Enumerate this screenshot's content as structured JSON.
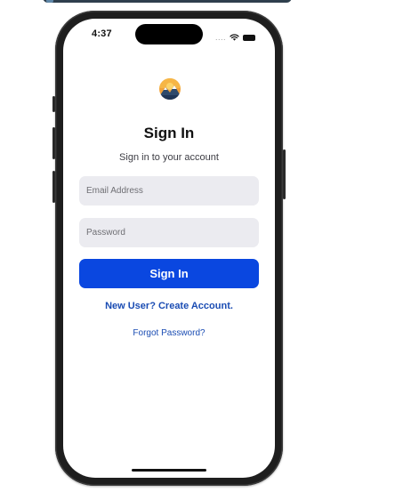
{
  "status_bar": {
    "time": "4:37",
    "signal_text": "....",
    "icons": [
      "wifi-icon",
      "battery-icon"
    ]
  },
  "logo": {
    "icon": "mountain-sunset-logo"
  },
  "heading": {
    "title": "Sign In",
    "subtitle": "Sign in to your account"
  },
  "form": {
    "email_placeholder": "Email Address",
    "email_value": "",
    "password_placeholder": "Password",
    "password_value": "",
    "submit_label": "Sign In"
  },
  "links": {
    "create_account": "New User? Create Account.",
    "forgot_password": "Forgot Password?"
  },
  "colors": {
    "primary": "#0A47E0",
    "link": "#1A4CB3",
    "field_background": "#EBEBF0",
    "frame": "#1E1E1E"
  }
}
